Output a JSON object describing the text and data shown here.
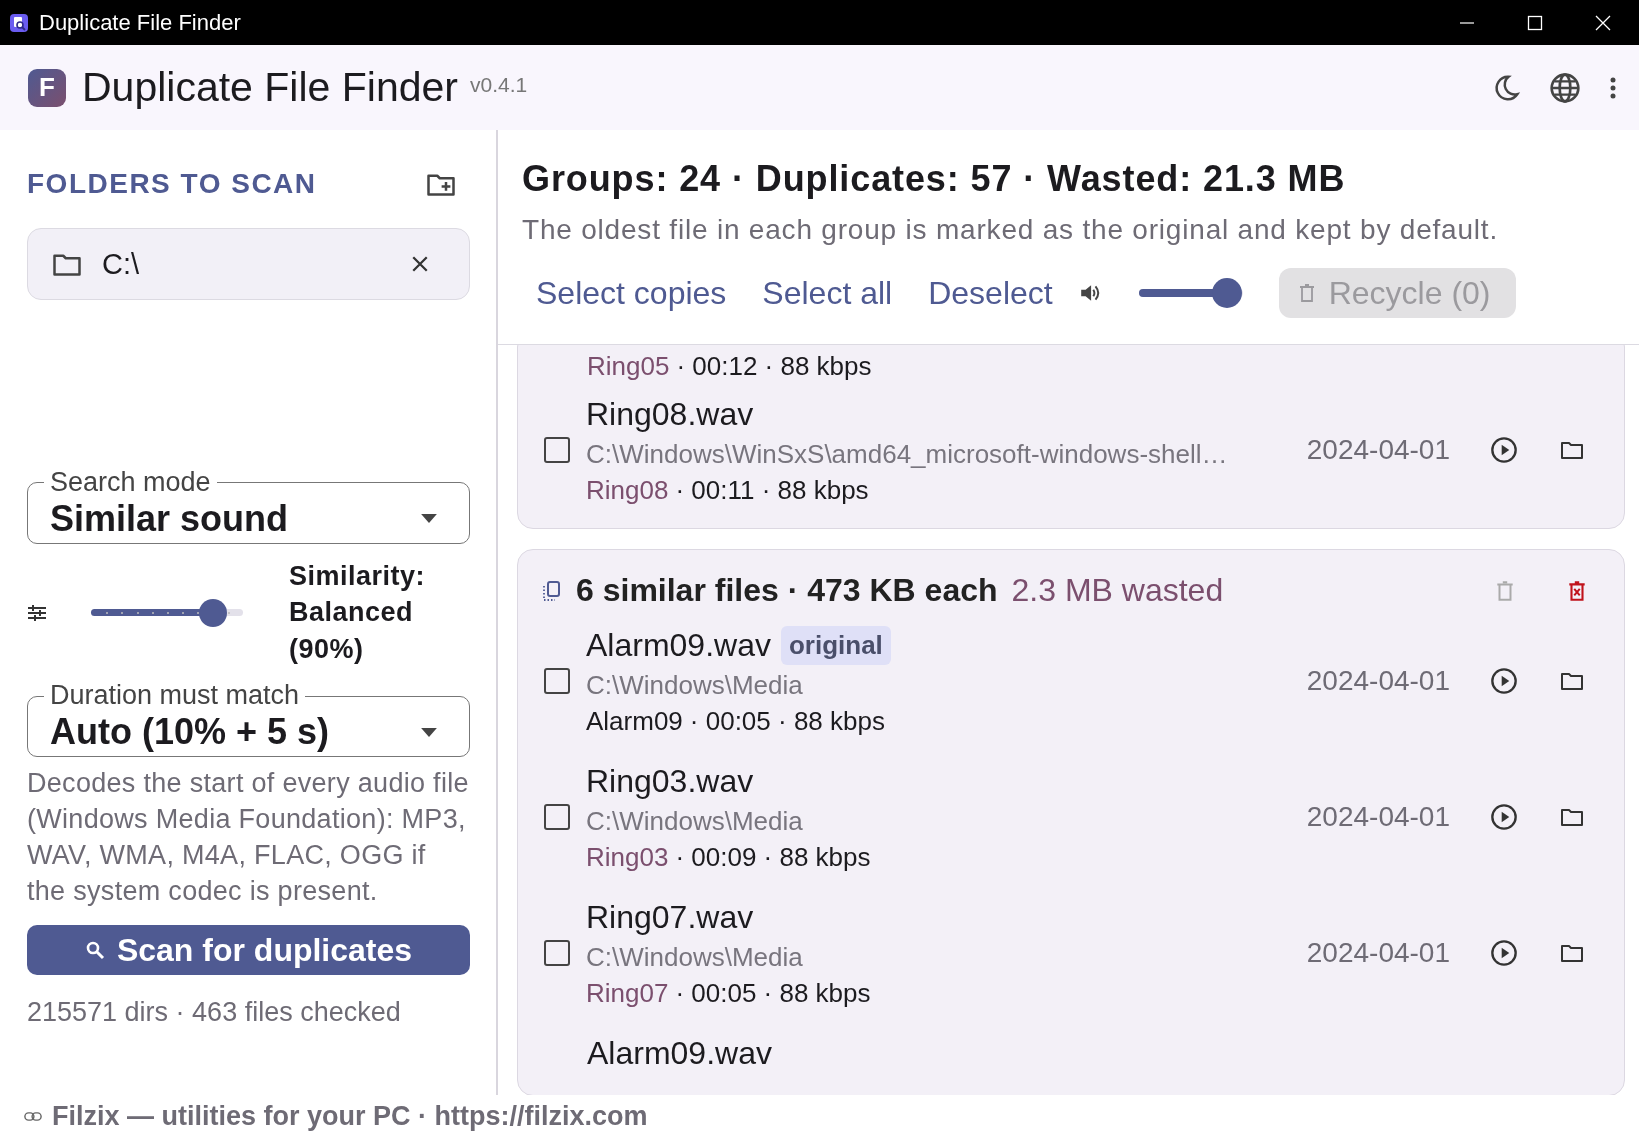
{
  "window": {
    "title": "Duplicate File Finder"
  },
  "header": {
    "logo": "F",
    "title": "Duplicate File Finder",
    "version": "v0.4.1"
  },
  "sidebar": {
    "heading": "FOLDERS TO SCAN",
    "folders": [
      {
        "path": "C:\\"
      }
    ],
    "search_mode": {
      "label": "Search mode",
      "value": "Similar sound"
    },
    "similarity": {
      "level": 0.8,
      "label": "Similarity: Balanced (90%)"
    },
    "duration": {
      "label": "Duration must match",
      "value": "Auto (10% + 5 s)"
    },
    "help": "Decodes the start of every audio file (Windows Media Foundation): MP3, WAV, WMA, M4A, FLAC, OGG if the system codec is present.",
    "scan_button": "Scan for duplicates",
    "status": "215571 dirs · 463 files checked"
  },
  "summary": {
    "title": "Groups: 24 · Duplicates: 57 · Wasted: 21.3 MB",
    "subtitle": "The oldest file in each group is marked as the original and kept by default.",
    "actions": [
      "Select copies",
      "Select all",
      "Deselect"
    ],
    "volume": {
      "level": 0.85
    },
    "recycle": {
      "label": "Recycle (0)",
      "disabled": true
    }
  },
  "groups": [
    {
      "files": [
        {
          "tag": "Ring05",
          "tag_highlighted": true,
          "details": "· 00:12 · 88 kbps"
        },
        {
          "name": "Ring08.wav",
          "path": "C:\\Windows\\WinSxS\\amd64_microsoft-windows-shell…",
          "tag": "Ring08",
          "tag_highlighted": true,
          "details": "· 00:11 · 88 kbps",
          "date": "2024-04-01",
          "checked": false
        }
      ]
    },
    {
      "title": "6 similar files · 473 KB each",
      "wasted": "2.3 MB wasted",
      "files": [
        {
          "name": "Alarm09.wav",
          "badge": "original",
          "path": "C:\\Windows\\Media",
          "tag": "Alarm09",
          "tag_highlighted": false,
          "details": "· 00:05 · 88 kbps",
          "date": "2024-04-01",
          "checked": false
        },
        {
          "name": "Ring03.wav",
          "path": "C:\\Windows\\Media",
          "tag": "Ring03",
          "tag_highlighted": true,
          "details": "· 00:09 · 88 kbps",
          "date": "2024-04-01",
          "checked": false
        },
        {
          "name": "Ring07.wav",
          "path": "C:\\Windows\\Media",
          "tag": "Ring07",
          "tag_highlighted": true,
          "details": "· 00:05 · 88 kbps",
          "date": "2024-04-01",
          "checked": false
        },
        {
          "name": "Alarm09.wav"
        }
      ]
    }
  ],
  "footer": "Filzix — utilities for your PC · https://filzix.com"
}
